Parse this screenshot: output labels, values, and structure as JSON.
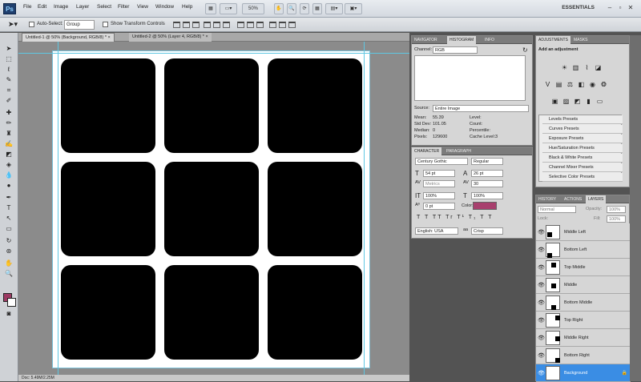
{
  "app": {
    "logo": "Ps",
    "menus": [
      "File",
      "Edit",
      "Image",
      "Layer",
      "Select",
      "Filter",
      "View",
      "Window",
      "Help"
    ],
    "zoom": "50%",
    "workspace": "ESSENTIALS"
  },
  "options": {
    "auto_select": "Auto-Select:",
    "auto_select_value": "Group",
    "show_transform": "Show Transform Controls"
  },
  "tabs": [
    "Untitled-1 @ 50% (Background, RGB/8) *",
    "Untitled-2 @ 50% (Layer 4, RGB/8) *"
  ],
  "status": "Doc: 5.49M/2.25M",
  "panel1": {
    "tabs": [
      "NAVIGATOR",
      "HISTOGRAM",
      "INFO"
    ],
    "channel_label": "Channel:",
    "channel_value": "RGB",
    "source_label": "Source:",
    "source_value": "Entire Image",
    "stats": [
      [
        "Mean:",
        "55.39",
        "Level:",
        ""
      ],
      [
        "Std Dev:",
        "101.05",
        "Count:",
        ""
      ],
      [
        "Median:",
        "0",
        "Percentile:",
        ""
      ],
      [
        "Pixels:",
        "129600",
        "Cache Level:",
        "3"
      ]
    ]
  },
  "panel2": {
    "tabs": [
      "CHARACTER",
      "PARAGRAPH"
    ],
    "font": "Century Gothic",
    "style": "Regular",
    "size": "54 pt",
    "leading": "26 pt",
    "kerning": "Metrics",
    "tracking": "30",
    "vscale": "100%",
    "hscale": "100%",
    "baseline": "0 pt",
    "color_label": "Color:",
    "lang": "English: USA",
    "aa": "Crisp",
    "color": "#a8406e"
  },
  "panel3": {
    "tabs": [
      "ADJUSTMENTS",
      "MASKS"
    ],
    "heading": "Add an adjustment",
    "presets": [
      "Levels Presets",
      "Curves Presets",
      "Exposure Presets",
      "Hue/Saturation Presets",
      "Black & White Presets",
      "Channel Mixer Presets",
      "Selective Color Presets"
    ]
  },
  "panel4": {
    "tabs": [
      "HISTORY",
      "ACTIONS",
      "LAYERS"
    ],
    "blend": "Normal",
    "opacity_label": "Opacity:",
    "opacity": "100%",
    "lock_label": "Lock:",
    "fill_label": "Fill:",
    "fill": "100%",
    "layers": [
      "Middle Left",
      "Bottom Left",
      "Top Middle",
      "Middle",
      "Bottom Middle",
      "Top Right",
      "Middle Right",
      "Bottom Right",
      "Background"
    ]
  }
}
